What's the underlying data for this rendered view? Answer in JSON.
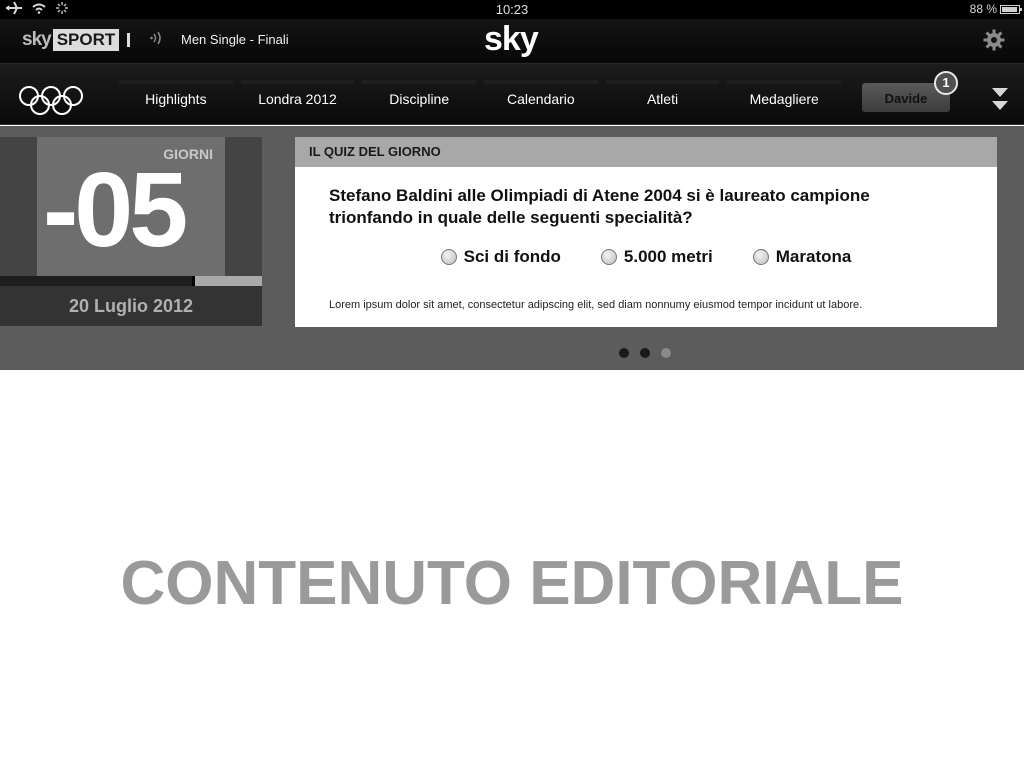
{
  "status_bar": {
    "time": "10:23",
    "battery": "88 %",
    "icons": [
      "airplane-icon",
      "wifi-icon",
      "activity-spinner-icon",
      "battery-icon"
    ]
  },
  "header": {
    "brand_sky": "sky",
    "brand_sport": "SPORT",
    "live_title": "Men Single - Finali",
    "logo": "sky",
    "icons": [
      "live-signal-icon",
      "gear-icon"
    ]
  },
  "nav": {
    "logo_icon": "olympic-rings-icon",
    "items": [
      {
        "label": "Highlights"
      },
      {
        "label": "Londra 2012"
      },
      {
        "label": "Discipline"
      },
      {
        "label": "Calendario"
      },
      {
        "label": "Atleti"
      },
      {
        "label": "Medagliere"
      }
    ],
    "user_button": "Davide",
    "badge_count": "1",
    "menu_icon": "double-chevron-down-icon"
  },
  "countdown": {
    "label": "GIORNI",
    "value": "-05",
    "date": "20 Luglio 2012",
    "progress": 0.74
  },
  "quiz": {
    "heading": "IL QUIZ DEL GIORNO",
    "question": "Stefano Baldini alle Olimpiadi di Atene 2004 si è laureato campione trionfando in quale delle seguenti specialità?",
    "options": [
      {
        "label": "Sci di fondo"
      },
      {
        "label": "5.000 metri"
      },
      {
        "label": "Maratona"
      }
    ],
    "footnote": "Lorem ipsum dolor sit amet, consectetur adipscing elit, sed diam nonnumy eiusmod tempor incidunt ut labore."
  },
  "pager": {
    "total": 3,
    "active": [
      0,
      1
    ]
  },
  "editorial": {
    "text": "CONTENUTO EDITORIALE"
  }
}
